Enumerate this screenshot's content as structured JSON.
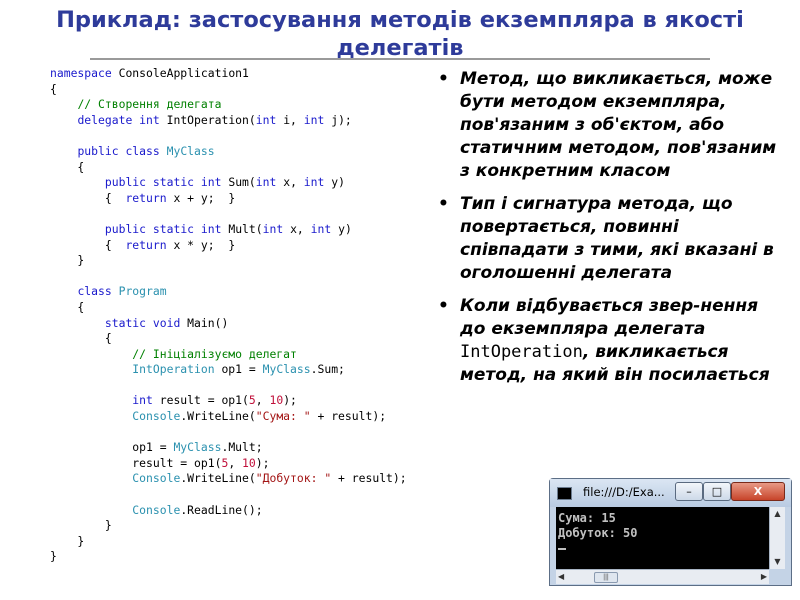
{
  "slide": {
    "title": "Приклад: застосування методів екземпляра в якості делегатів"
  },
  "code": {
    "lines": [
      [
        {
          "t": "namespace",
          "c": "kw"
        },
        {
          "t": " ConsoleApplication1",
          "c": ""
        }
      ],
      [
        {
          "t": "{",
          "c": ""
        }
      ],
      [
        {
          "t": "    ",
          "c": ""
        },
        {
          "t": "// Створення делегата",
          "c": "cm"
        }
      ],
      [
        {
          "t": "    ",
          "c": ""
        },
        {
          "t": "delegate",
          "c": "kw"
        },
        {
          "t": " ",
          "c": ""
        },
        {
          "t": "int",
          "c": "kw"
        },
        {
          "t": " IntOperation(",
          "c": ""
        },
        {
          "t": "int",
          "c": "kw"
        },
        {
          "t": " i, ",
          "c": ""
        },
        {
          "t": "int",
          "c": "kw"
        },
        {
          "t": " j);",
          "c": ""
        }
      ],
      [
        {
          "t": "",
          "c": ""
        }
      ],
      [
        {
          "t": "    ",
          "c": ""
        },
        {
          "t": "public",
          "c": "kw"
        },
        {
          "t": " ",
          "c": ""
        },
        {
          "t": "class",
          "c": "kw"
        },
        {
          "t": " ",
          "c": ""
        },
        {
          "t": "MyClass",
          "c": "ty"
        }
      ],
      [
        {
          "t": "    {",
          "c": ""
        }
      ],
      [
        {
          "t": "        ",
          "c": ""
        },
        {
          "t": "public",
          "c": "kw"
        },
        {
          "t": " ",
          "c": ""
        },
        {
          "t": "static",
          "c": "kw"
        },
        {
          "t": " ",
          "c": ""
        },
        {
          "t": "int",
          "c": "kw"
        },
        {
          "t": " Sum(",
          "c": ""
        },
        {
          "t": "int",
          "c": "kw"
        },
        {
          "t": " x, ",
          "c": ""
        },
        {
          "t": "int",
          "c": "kw"
        },
        {
          "t": " y)",
          "c": ""
        }
      ],
      [
        {
          "t": "        {  ",
          "c": ""
        },
        {
          "t": "return",
          "c": "kw"
        },
        {
          "t": " x + y;  }",
          "c": ""
        }
      ],
      [
        {
          "t": "",
          "c": ""
        }
      ],
      [
        {
          "t": "        ",
          "c": ""
        },
        {
          "t": "public",
          "c": "kw"
        },
        {
          "t": " ",
          "c": ""
        },
        {
          "t": "static",
          "c": "kw"
        },
        {
          "t": " ",
          "c": ""
        },
        {
          "t": "int",
          "c": "kw"
        },
        {
          "t": " Mult(",
          "c": ""
        },
        {
          "t": "int",
          "c": "kw"
        },
        {
          "t": " x, ",
          "c": ""
        },
        {
          "t": "int",
          "c": "kw"
        },
        {
          "t": " y)",
          "c": ""
        }
      ],
      [
        {
          "t": "        {  ",
          "c": ""
        },
        {
          "t": "return",
          "c": "kw"
        },
        {
          "t": " x * y;  }",
          "c": ""
        }
      ],
      [
        {
          "t": "    }",
          "c": ""
        }
      ],
      [
        {
          "t": "",
          "c": ""
        }
      ],
      [
        {
          "t": "    ",
          "c": ""
        },
        {
          "t": "class",
          "c": "kw"
        },
        {
          "t": " ",
          "c": ""
        },
        {
          "t": "Program",
          "c": "ty"
        }
      ],
      [
        {
          "t": "    {",
          "c": ""
        }
      ],
      [
        {
          "t": "        ",
          "c": ""
        },
        {
          "t": "static",
          "c": "kw"
        },
        {
          "t": " ",
          "c": ""
        },
        {
          "t": "void",
          "c": "kw"
        },
        {
          "t": " Main()",
          "c": ""
        }
      ],
      [
        {
          "t": "        {",
          "c": ""
        }
      ],
      [
        {
          "t": "            ",
          "c": ""
        },
        {
          "t": "// Ініціалізуємо делегат",
          "c": "cm"
        }
      ],
      [
        {
          "t": "            ",
          "c": ""
        },
        {
          "t": "IntOperation",
          "c": "ty"
        },
        {
          "t": " op1 = ",
          "c": ""
        },
        {
          "t": "MyClass",
          "c": "ty"
        },
        {
          "t": ".Sum;",
          "c": ""
        }
      ],
      [
        {
          "t": "",
          "c": ""
        }
      ],
      [
        {
          "t": "            ",
          "c": ""
        },
        {
          "t": "int",
          "c": "kw"
        },
        {
          "t": " result = op1(",
          "c": ""
        },
        {
          "t": "5",
          "c": "num"
        },
        {
          "t": ", ",
          "c": ""
        },
        {
          "t": "10",
          "c": "num"
        },
        {
          "t": ");",
          "c": ""
        }
      ],
      [
        {
          "t": "            ",
          "c": ""
        },
        {
          "t": "Console",
          "c": "ty"
        },
        {
          "t": ".WriteLine(",
          "c": ""
        },
        {
          "t": "\"Сума: \"",
          "c": "str"
        },
        {
          "t": " + result);",
          "c": ""
        }
      ],
      [
        {
          "t": "",
          "c": ""
        }
      ],
      [
        {
          "t": "            op1 = ",
          "c": ""
        },
        {
          "t": "MyClass",
          "c": "ty"
        },
        {
          "t": ".Mult;",
          "c": ""
        }
      ],
      [
        {
          "t": "            result = op1(",
          "c": ""
        },
        {
          "t": "5",
          "c": "num"
        },
        {
          "t": ", ",
          "c": ""
        },
        {
          "t": "10",
          "c": "num"
        },
        {
          "t": ");",
          "c": ""
        }
      ],
      [
        {
          "t": "            ",
          "c": ""
        },
        {
          "t": "Console",
          "c": "ty"
        },
        {
          "t": ".WriteLine(",
          "c": ""
        },
        {
          "t": "\"Добуток: \"",
          "c": "str"
        },
        {
          "t": " + result);",
          "c": ""
        }
      ],
      [
        {
          "t": "",
          "c": ""
        }
      ],
      [
        {
          "t": "            ",
          "c": ""
        },
        {
          "t": "Console",
          "c": "ty"
        },
        {
          "t": ".ReadLine();",
          "c": ""
        }
      ],
      [
        {
          "t": "        }",
          "c": ""
        }
      ],
      [
        {
          "t": "    }",
          "c": ""
        }
      ],
      [
        {
          "t": "}",
          "c": ""
        }
      ]
    ]
  },
  "bullets": {
    "marker": "•",
    "b1": "Метод, що викликається, може бути методом екземпляра, пов'язаним з об'єктом, або статичним методом, пов'язаним з конкретним класом",
    "b2": "Тип і сигнатура метода, що повертається, повинні співпадати з тими, які вказані в оголошенні делегата",
    "b3_before": "Коли відбувається звер-нення до екземпляра делегата ",
    "b3_mono": "IntOperation",
    "b3_after": ", викликається метод, на який він посилається"
  },
  "console": {
    "title": "file:///D:/Exa...",
    "min_glyph": "–",
    "max_glyph": "□",
    "close_glyph": "X",
    "lines": [
      "Сума: 15",
      "Добуток: 50"
    ],
    "scroll_up": "▲",
    "scroll_down": "▼",
    "scroll_left": "◀",
    "scroll_right": "▶",
    "thumb_grip": "|||"
  }
}
